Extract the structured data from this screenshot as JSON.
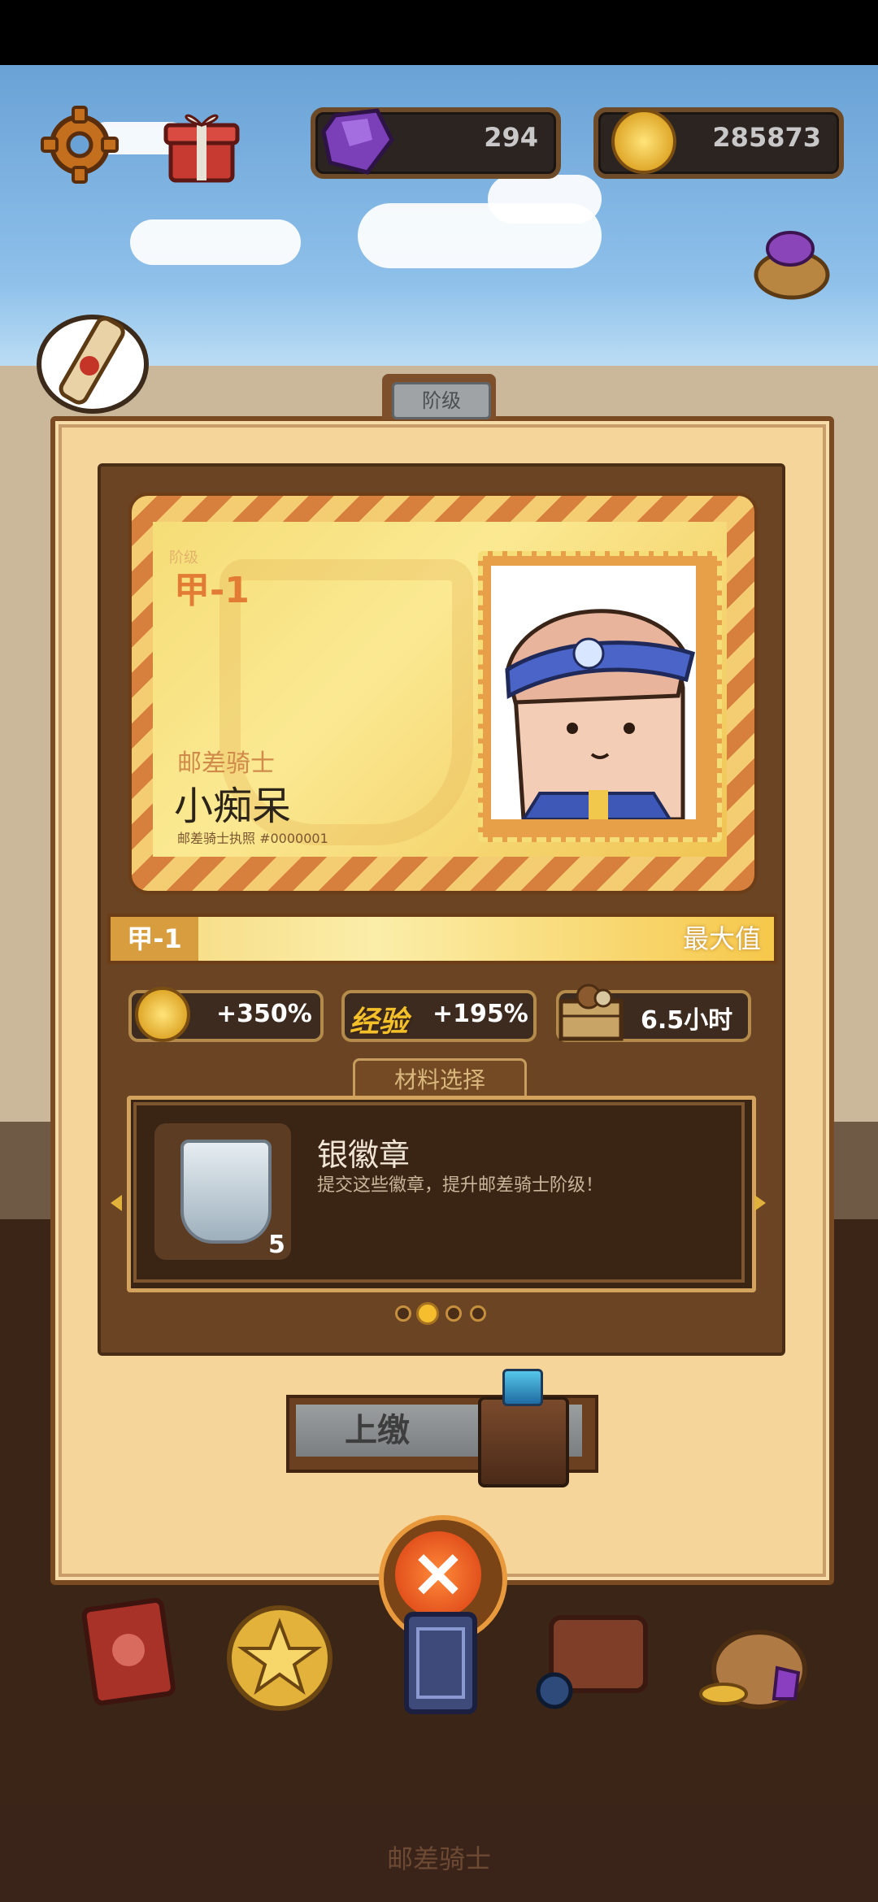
{
  "hud": {
    "gems": "294",
    "coins": "285873",
    "icons": [
      "gear-icon",
      "gift-icon",
      "gem-icon",
      "gold-coin-icon",
      "gem-sack-icon",
      "scroll-bubble-icon"
    ]
  },
  "dialog": {
    "title": "阶级",
    "card": {
      "rank_small": "阶级",
      "rank": "甲-1",
      "role": "邮差骑士",
      "name": "小痴呆",
      "license": "邮差骑士执照 #0000001"
    },
    "rank_bar": {
      "left": "甲-1",
      "right": "最大值",
      "progress": 1.0
    },
    "stats": {
      "coin_bonus": "+350%",
      "exp_label": "经验",
      "exp_bonus": "+195%",
      "time": "6.5小时"
    },
    "material": {
      "tab": "材料选择",
      "name": "银徽章",
      "desc": "提交这些徽章，提升邮差骑士阶级！",
      "count": "5",
      "page_index": 2,
      "page_total": 4
    },
    "submit_label": "上缴"
  },
  "footer": {
    "title": "邮差骑士",
    "nav_icons": [
      "red-book-icon",
      "star-coin-icon",
      "card-deck-icon",
      "bag-potion-icon",
      "treasure-sack-icon"
    ]
  },
  "colors": {
    "panel": "#f5d59a",
    "frame": "#6b4424",
    "accent": "#e27b33",
    "gold": "#f4be2e"
  }
}
